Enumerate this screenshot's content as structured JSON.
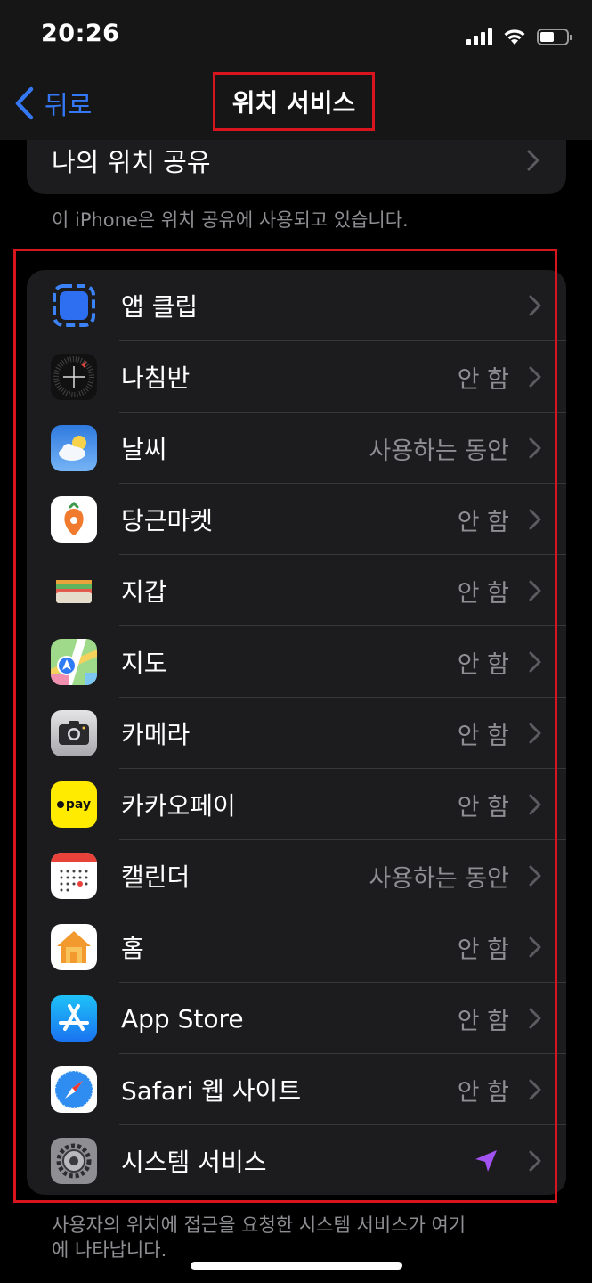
{
  "status_bar": {
    "time": "20:26"
  },
  "nav": {
    "back_label": "뒤로",
    "title": "위치 서비스"
  },
  "share": {
    "label": "나의 위치 공유",
    "caption": "이 iPhone은 위치 공유에 사용되고 있습니다."
  },
  "apps": [
    {
      "name": "앱 클립",
      "value": "",
      "icon": "app-clips-icon"
    },
    {
      "name": "나침반",
      "value": "안 함",
      "icon": "compass-icon"
    },
    {
      "name": "날씨",
      "value": "사용하는 동안",
      "icon": "weather-icon"
    },
    {
      "name": "당근마켓",
      "value": "안 함",
      "icon": "carrot-market-icon"
    },
    {
      "name": "지갑",
      "value": "안 함",
      "icon": "wallet-icon"
    },
    {
      "name": "지도",
      "value": "안 함",
      "icon": "maps-icon"
    },
    {
      "name": "카메라",
      "value": "안 함",
      "icon": "camera-icon"
    },
    {
      "name": "카카오페이",
      "value": "안 함",
      "icon": "kakaopay-icon",
      "icon_text": "pay"
    },
    {
      "name": "캘린더",
      "value": "사용하는 동안",
      "icon": "calendar-icon"
    },
    {
      "name": "홈",
      "value": "안 함",
      "icon": "home-icon"
    },
    {
      "name": "App Store",
      "value": "안 함",
      "icon": "app-store-icon"
    },
    {
      "name": "Safari 웹 사이트",
      "value": "안 함",
      "icon": "safari-icon"
    },
    {
      "name": "시스템 서비스",
      "value": "",
      "icon": "settings-gear-icon",
      "indicator": "location-arrow-icon"
    }
  ],
  "footer_caption": "사용자의 위치에 접근을 요청한 시스템 서비스가 여기에 나타납니다.",
  "colors": {
    "accent": "#3478f6",
    "highlight": "#d8141e",
    "location_arrow": "#a152f0"
  }
}
